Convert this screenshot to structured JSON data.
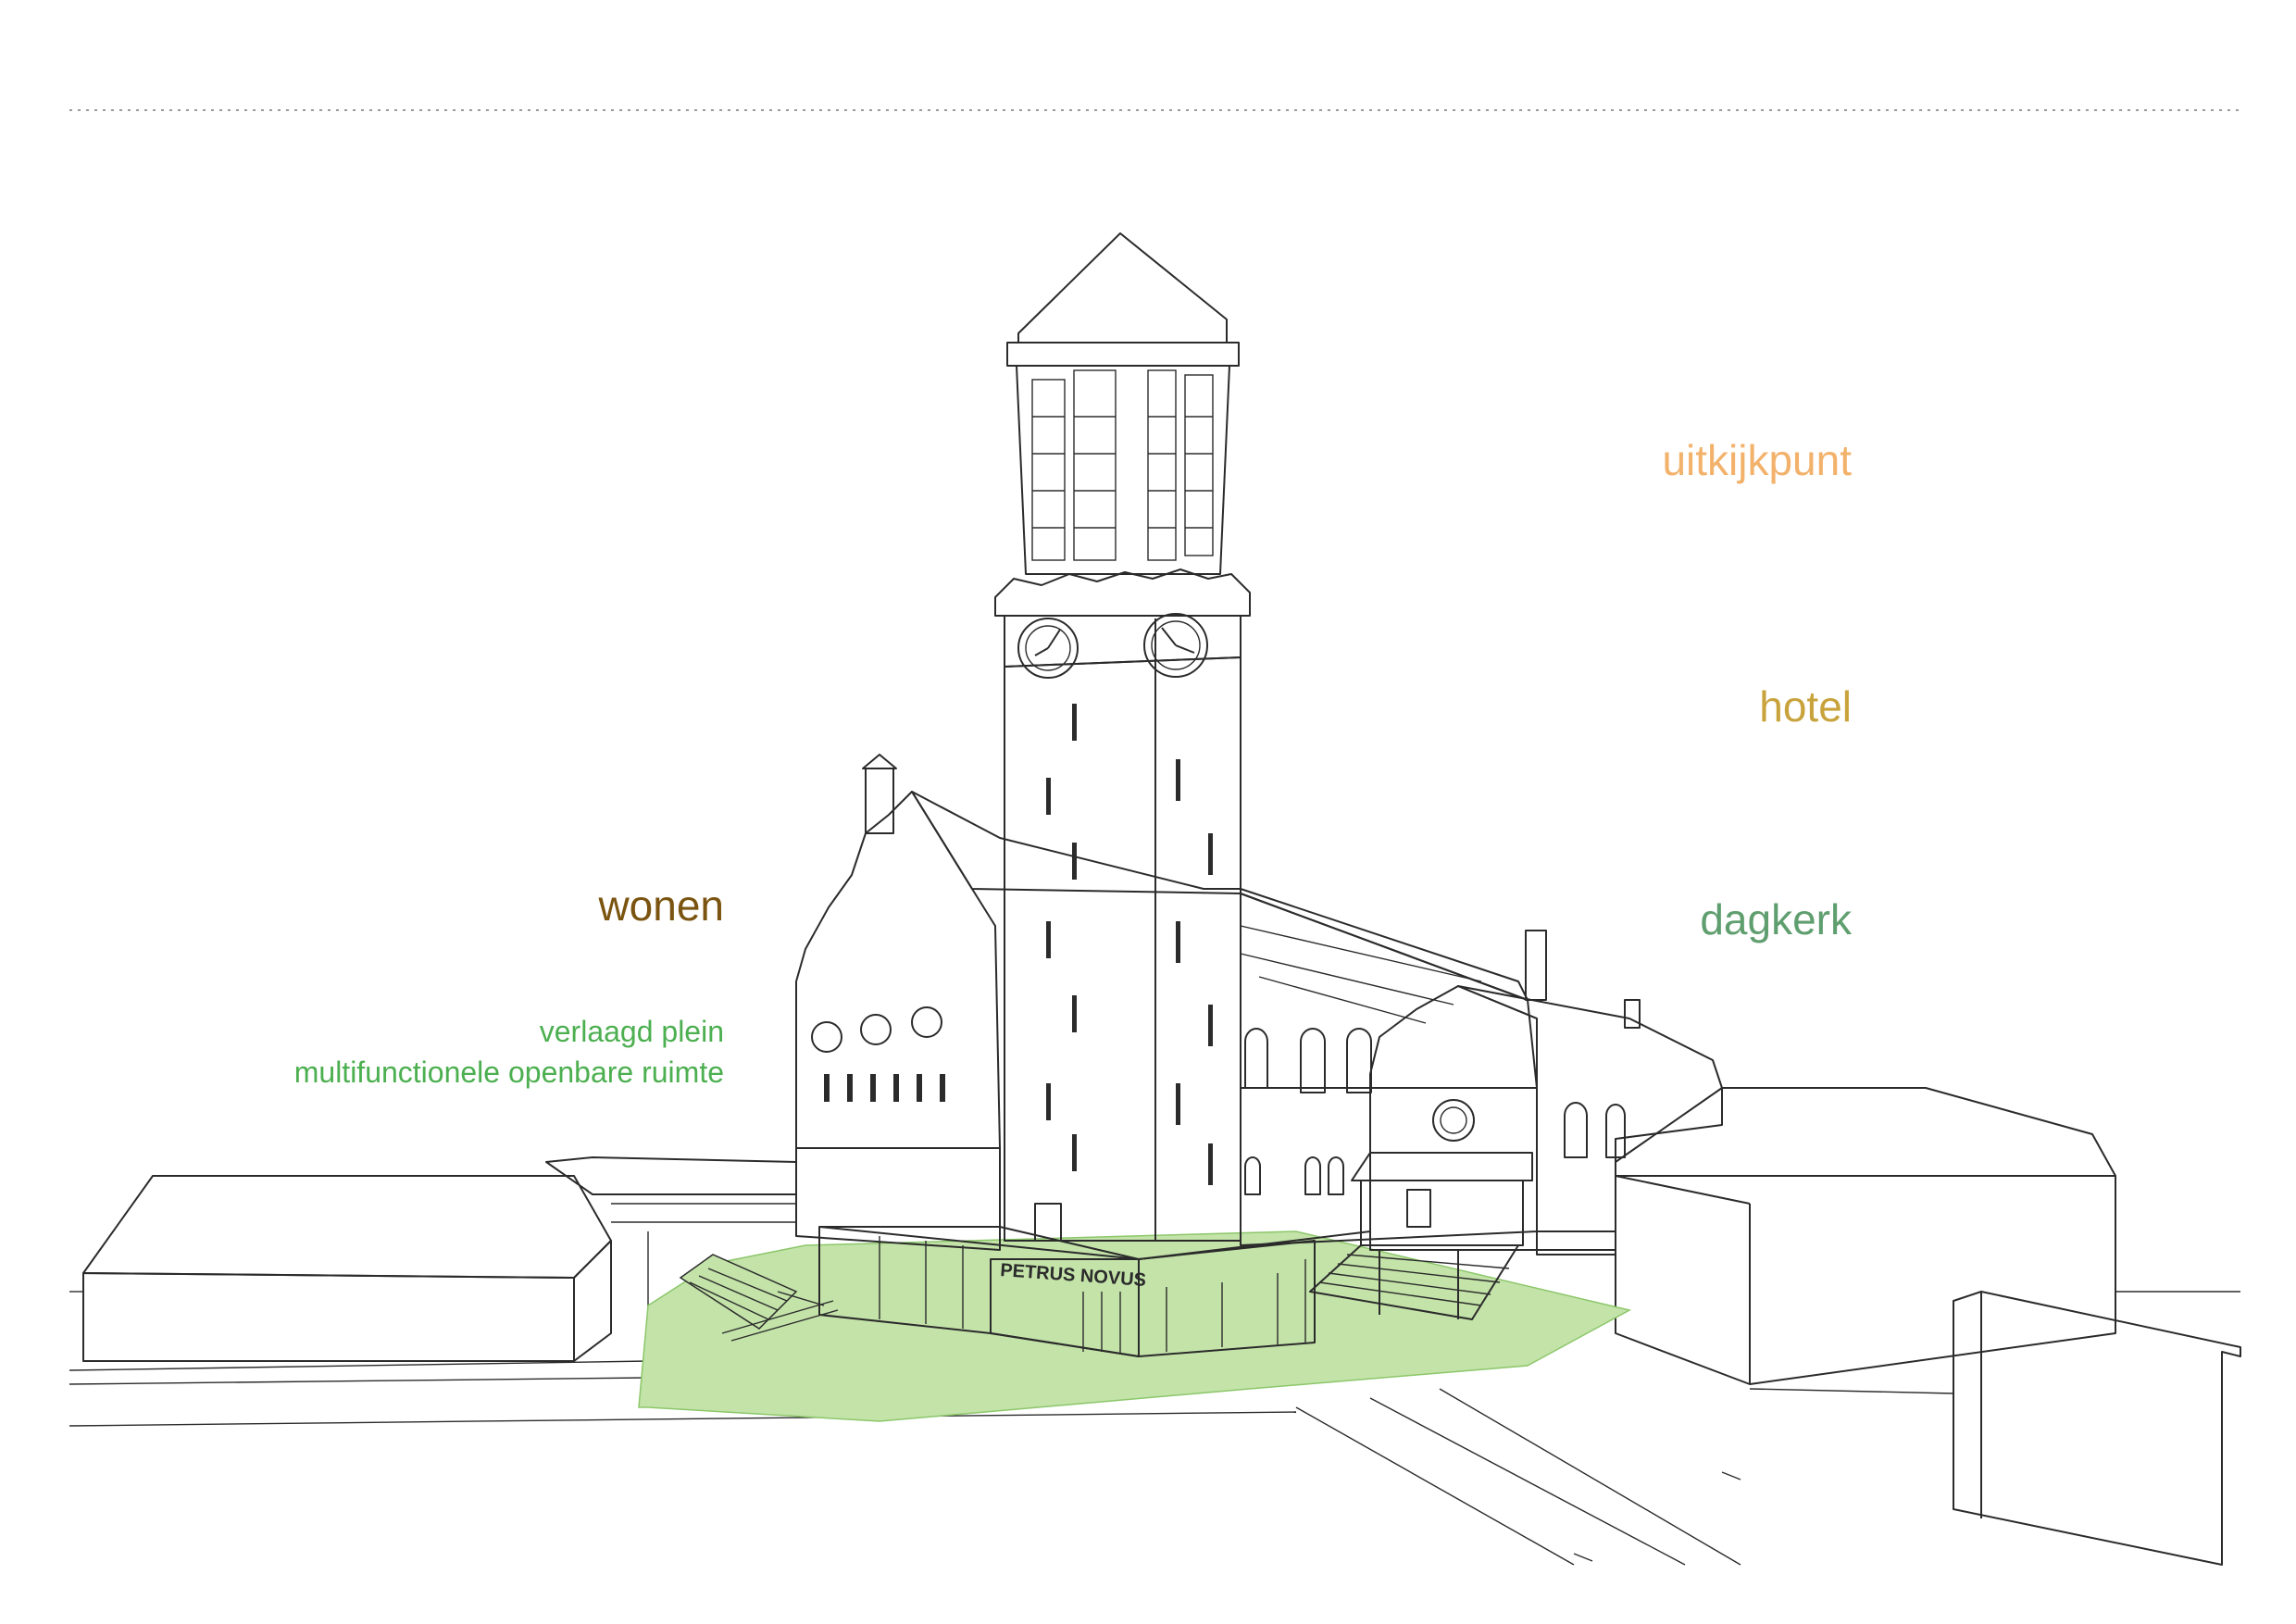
{
  "colors": {
    "uitkijkpunt": "#f3b26b",
    "hotel": "#c8a23a",
    "wonen": "#7a5410",
    "dagkerk": "#5f9e6e",
    "plein": "#4caf50",
    "tower_top_fill": "#f9c99a",
    "tower_mid_fill": "#e0c582",
    "house_fill": "#c4a57a",
    "church_fill": "#86bf92",
    "plaza_fill": "#c3e3a9"
  },
  "labels": {
    "uitkijkpunt": "uitkijkpunt",
    "hotel": "hotel",
    "dagkerk": "dagkerk",
    "wonen": "wonen",
    "plein_line1": "verlaagd plein",
    "plein_line2": "multifunctionele openbare ruimte"
  },
  "signage": {
    "building_name": "PETRUS NOVUS"
  }
}
